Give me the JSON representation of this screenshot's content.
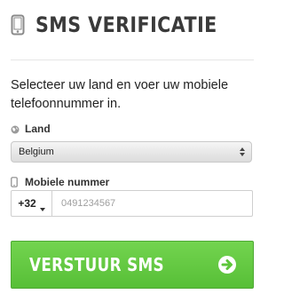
{
  "header": {
    "title": "SMS VERIFICATIE",
    "icon": "phone-icon"
  },
  "intro": {
    "text": "Selecteer uw land en voer uw mobiele telefoonnummer in."
  },
  "country": {
    "label": "Land",
    "icon": "globe-icon",
    "selected": "Belgium"
  },
  "mobile": {
    "label": "Mobiele nummer",
    "icon": "phone-icon",
    "country_code": "+32",
    "placeholder": "0491234567",
    "value": ""
  },
  "submit": {
    "label": "VERSTUUR SMS",
    "icon": "arrow-right-circle-icon"
  },
  "colors": {
    "primary_green": "#5ec63b",
    "title_text": "#3a3a3a",
    "divider": "#e6e6e6"
  }
}
